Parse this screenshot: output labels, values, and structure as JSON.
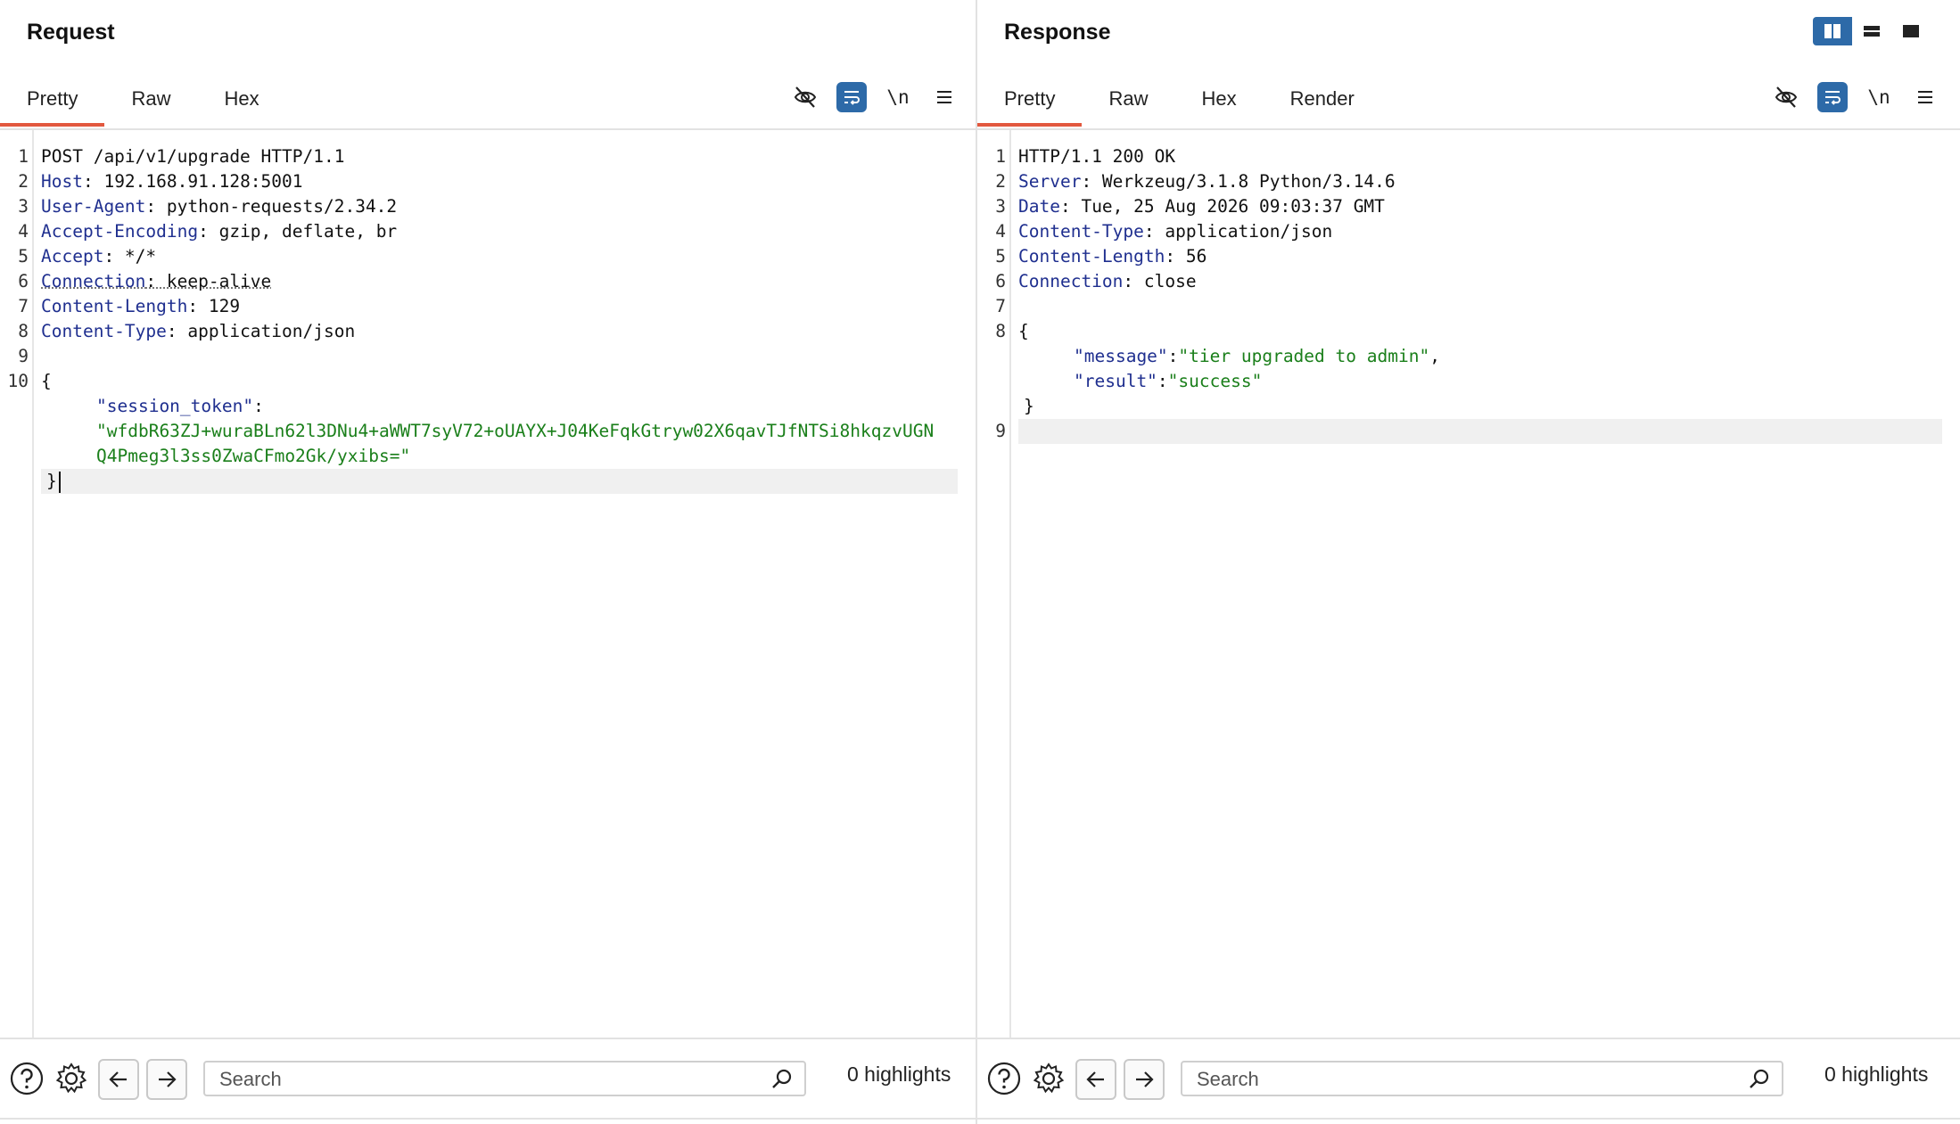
{
  "request": {
    "title": "Request",
    "tabs": [
      {
        "label": "Pretty",
        "active": true
      },
      {
        "label": "Raw",
        "active": false
      },
      {
        "label": "Hex",
        "active": false
      }
    ],
    "toolbar": {
      "hide_icon": "eye-slash-icon",
      "wrap_icon": "wrap-lines-icon",
      "newline_label": "\\n",
      "menu_icon": "hamburger-menu-icon"
    },
    "line_numbers": [
      "1",
      "2",
      "3",
      "4",
      "5",
      "6",
      "7",
      "8",
      "9",
      "10"
    ],
    "lines": {
      "l1": "POST /api/v1/upgrade HTTP/1.1",
      "l2_name": "Host",
      "l2_value": ": 192.168.91.128:5001",
      "l3_name": "User-Agent",
      "l3_value": ": python-requests/2.34.2",
      "l4_name": "Accept-Encoding",
      "l4_value": ": gzip, deflate, br",
      "l5_name": "Accept",
      "l5_value": ": */*",
      "l6_name": "Connection",
      "l6_value": ": keep-alive",
      "l7_name": "Content-Length",
      "l7_value": ": 129",
      "l8_name": "Content-Type",
      "l8_value": ": application/json",
      "l10": "{",
      "key_session": "\"session_token\"",
      "colon": ":",
      "token_part1": "\"wfdbR63ZJ+wuraBLn62l3DNu4+aWWT7syV72+oUAYX+J04KeFqkGtryw02X6qavTJfNTSi8hkqzvUGN",
      "token_part2": "Q4Pmeg3l3ss0ZwaCFmo2Gk/yxibs=\"",
      "close": "}"
    },
    "search": {
      "placeholder": "Search",
      "highlights": "0 highlights"
    }
  },
  "response": {
    "title": "Response",
    "tabs": [
      {
        "label": "Pretty",
        "active": true
      },
      {
        "label": "Raw",
        "active": false
      },
      {
        "label": "Hex",
        "active": false
      },
      {
        "label": "Render",
        "active": false
      }
    ],
    "toolbar": {
      "hide_icon": "eye-slash-icon",
      "wrap_icon": "wrap-lines-icon",
      "newline_label": "\\n",
      "menu_icon": "hamburger-menu-icon"
    },
    "line_numbers": [
      "1",
      "2",
      "3",
      "4",
      "5",
      "6",
      "7",
      "8",
      "9"
    ],
    "lines": {
      "l1": "HTTP/1.1 200 OK",
      "l2_name": "Server",
      "l2_value": ": Werkzeug/3.1.8 Python/3.14.6",
      "l3_name": "Date",
      "l3_value": ": Tue, 25 Aug 2026 09:03:37 GMT",
      "l4_name": "Content-Type",
      "l4_value": ": application/json",
      "l5_name": "Content-Length",
      "l5_value": ": 56",
      "l6_name": "Connection",
      "l6_value": ": close",
      "l8": "{",
      "key_message": "\"message\"",
      "val_message": "\"tier upgraded to admin\"",
      "key_result": "\"result\"",
      "val_result": "\"success\"",
      "colon": ":",
      "comma": ",",
      "close": "}"
    },
    "search": {
      "placeholder": "Search",
      "highlights": "0 highlights"
    }
  },
  "view_toggle": {
    "options": [
      "side-by-side-icon",
      "stacked-icon",
      "single-pane-icon"
    ],
    "active": "side-by-side-icon"
  },
  "colors": {
    "accent_tab": "#e2583e",
    "active_button": "#2d6aa8",
    "header_name": "#1f2f8f",
    "json_string": "#1a7f1a"
  }
}
